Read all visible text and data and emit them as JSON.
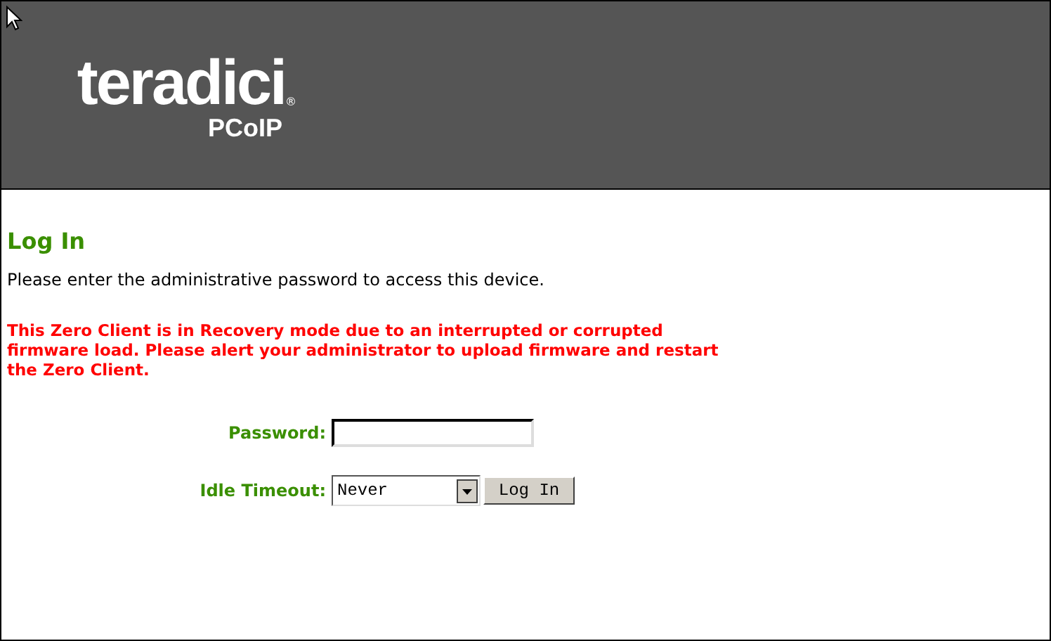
{
  "header": {
    "logo": {
      "name": "teradici",
      "mark": "®",
      "product": "PCoIP"
    }
  },
  "page": {
    "title": "Log In",
    "instruction": "Please enter the administrative password to access this device.",
    "warning": "This Zero Client is in Recovery mode due to an interrupted or corrupted firmware load. Please alert your administrator to upload firmware and restart the Zero Client."
  },
  "form": {
    "password_label": "Password:",
    "timeout_label": "Idle Timeout:",
    "timeout_value": "Never",
    "button": "Log In"
  }
}
